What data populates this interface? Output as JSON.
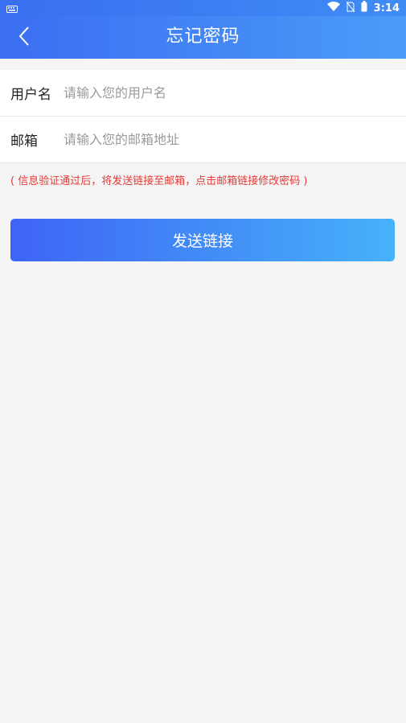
{
  "status_bar": {
    "time": "3:14",
    "icons": [
      "keyboard-icon",
      "wifi-icon",
      "no-sim-icon",
      "battery-icon"
    ]
  },
  "header": {
    "title": "忘记密码",
    "back_icon": "chevron-left-icon"
  },
  "form": {
    "username": {
      "label": "用户名",
      "placeholder": "请输入您的用户名"
    },
    "email": {
      "label": "邮箱",
      "placeholder": "请输入您的邮箱地址"
    }
  },
  "hint": "( 信息验证通过后，将发送链接至邮箱，点击邮箱链接修改密码 )",
  "send_button": {
    "label": "发送链接"
  },
  "colors": {
    "header_start": "#3b6ef2",
    "header_end": "#4a9cf8",
    "button_start": "#3e64f5",
    "button_end": "#46b2fa",
    "hint": "#e53935",
    "background": "#f5f5f5"
  }
}
